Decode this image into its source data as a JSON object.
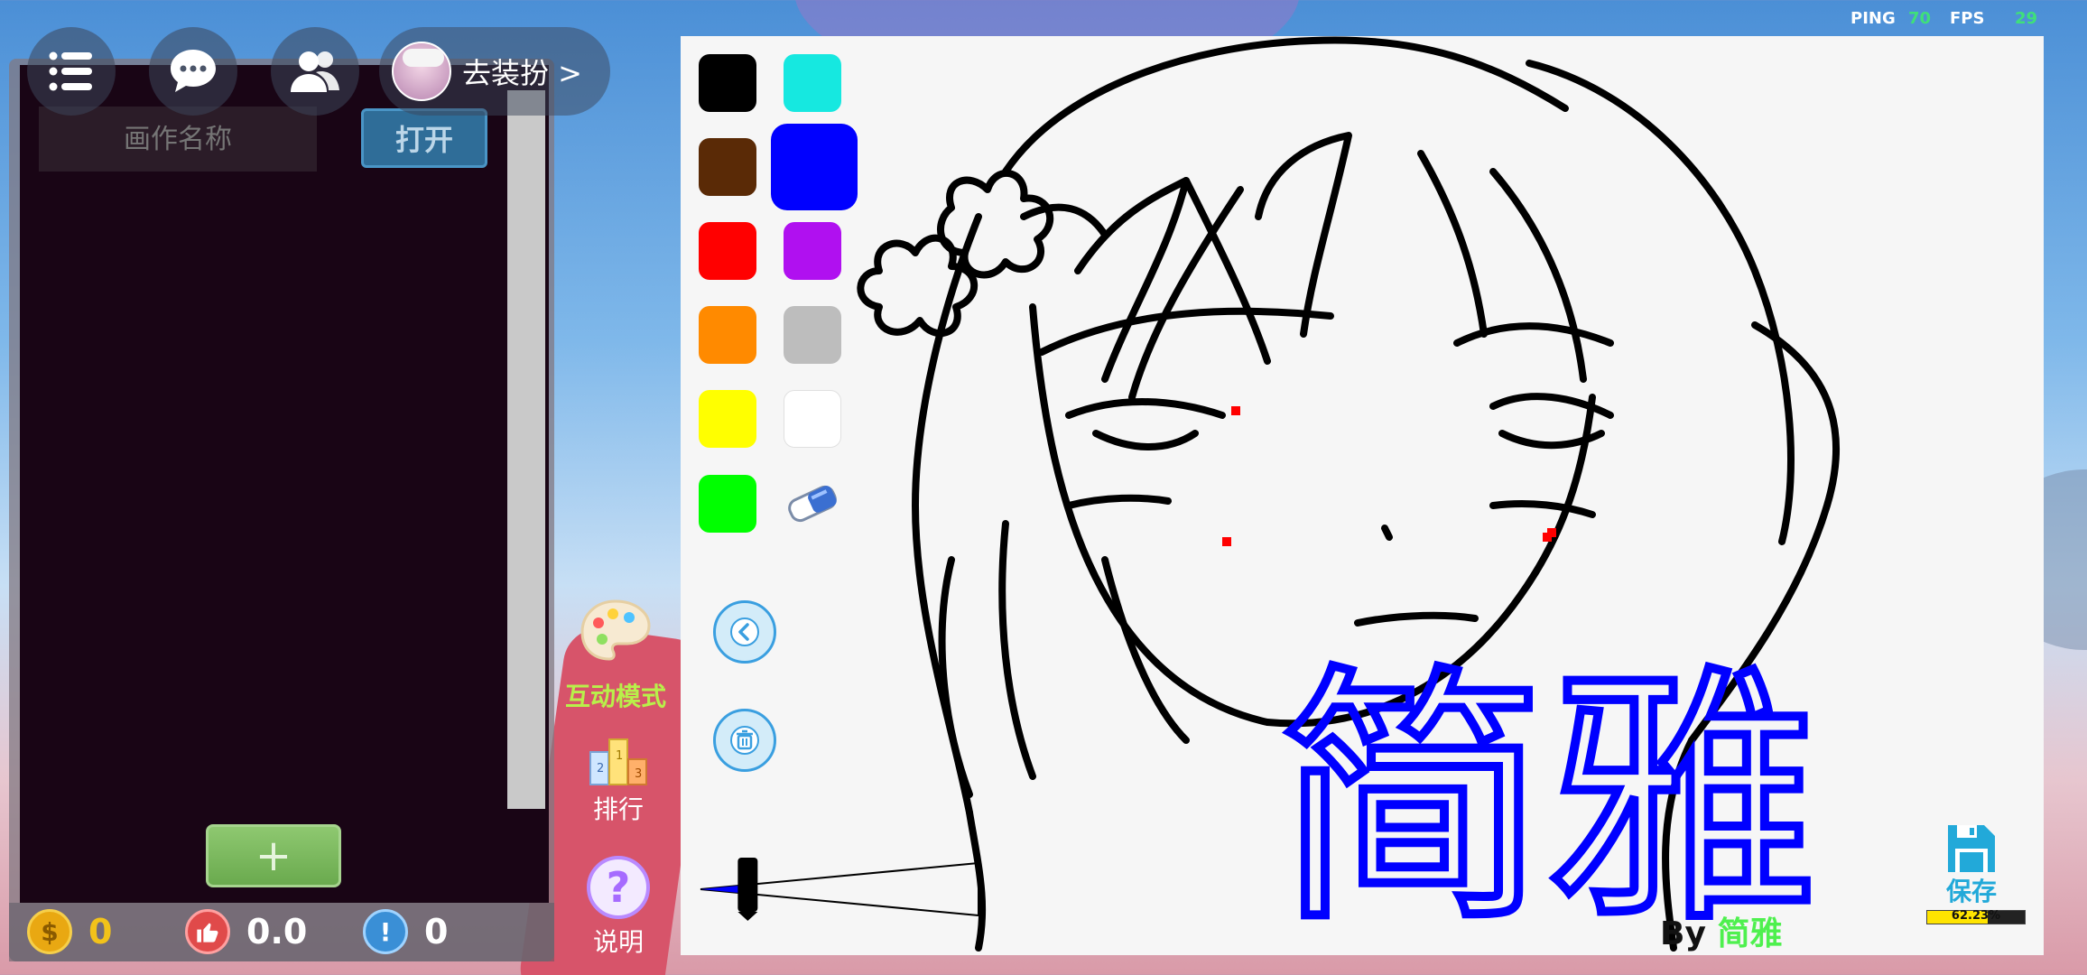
{
  "hud": {
    "ping_label": "PING",
    "ping_value": "70",
    "fps_label": "FPS",
    "fps_value": "29"
  },
  "toolbar": {
    "menu_icon": "list-icon",
    "chat_icon": "chat-bubble-icon",
    "friends_icon": "friends-icon",
    "dress_up_label": "去装扮 >"
  },
  "gallery": {
    "name_placeholder": "画作名称",
    "open_label": "打开",
    "add_label": "+"
  },
  "stats": {
    "coins": "0",
    "likes": "0.0",
    "reports": "0"
  },
  "side_buttons": {
    "interactive_mode": "互动模式",
    "ranking": "排行",
    "help": "说明"
  },
  "palette": {
    "colors": [
      "#000000",
      "#16e8e0",
      "#5a2a06",
      "#0000ff",
      "#ff0000",
      "#b010f0",
      "#ff8a00",
      "#bdbdbd",
      "#ffff00",
      "#ffffff",
      "#00ff00"
    ],
    "selected": "#0000ff",
    "eraser_icon": "eraser-icon",
    "undo_icon": "undo-icon",
    "clear_icon": "trash-icon"
  },
  "brush": {
    "size_fraction": 0.17
  },
  "signature": {
    "prefix": "By",
    "name": "简雅"
  },
  "canvas_text": "简雅",
  "save": {
    "label": "保存",
    "progress_percent": 62.23,
    "progress_text": "62.23%",
    "icon": "save-icon"
  }
}
